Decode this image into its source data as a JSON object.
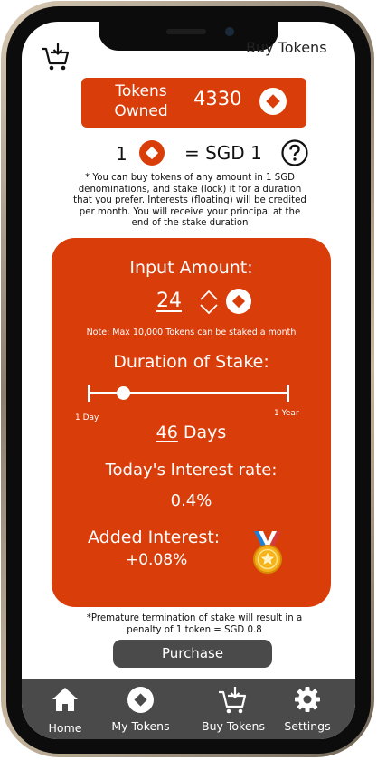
{
  "header": {
    "title": "Buy Tokens",
    "cart_icon": "cart-download-icon"
  },
  "tokens_owned": {
    "label": "Tokens Owned",
    "value": "4330",
    "icon": "token-coin-icon"
  },
  "rate": {
    "qty": "1",
    "equals": "= SGD 1",
    "icon": "token-coin-icon",
    "help_icon": "question-icon"
  },
  "disclaimer": "* You can buy tokens of any amount in 1 SGD denominations, and stake (lock) it for a duration that you prefer. Interests (floating) will be credited per month. You will receive your principal at the end of the stake duration",
  "stake": {
    "input_label": "Input Amount:",
    "amount": "24",
    "note": "Note: Max 10,000 Tokens can be staked a month",
    "duration_label": "Duration of Stake:",
    "slider_fraction": 0.173,
    "min_label": "1 Day",
    "max_label": "1 Year",
    "days_value": "46",
    "days_unit": "Days",
    "interest_label": "Today's Interest rate:",
    "interest_value": "0.4%",
    "added_label": "Added Interest:",
    "added_value": "+0.08%"
  },
  "premature_note": "*Premature termination of stake will result in a penalty of 1 token = SGD 0.8",
  "purchase_label": "Purchase",
  "tabs": [
    {
      "label": "Home",
      "icon": "home-icon"
    },
    {
      "label": "My Tokens",
      "icon": "token-coin-icon"
    },
    {
      "label": "Buy Tokens",
      "icon": "cart-download-icon"
    },
    {
      "label": "Settings",
      "icon": "gear-icon"
    }
  ],
  "colors": {
    "accent": "#d93d0a",
    "dark": "#4a4a4a",
    "text": "#111111",
    "medal": "#f5b21b"
  }
}
